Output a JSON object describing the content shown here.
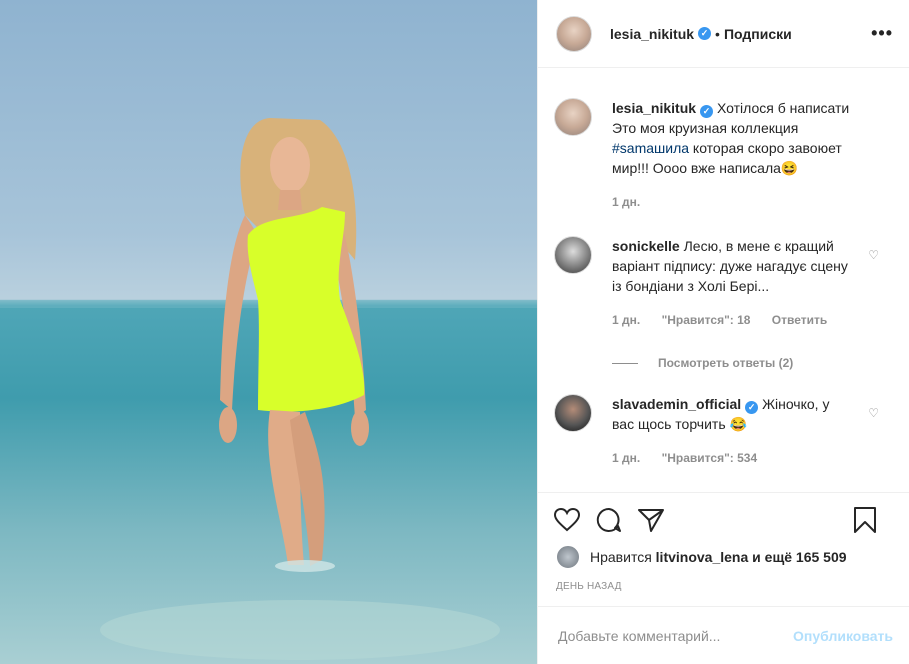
{
  "post": {
    "image_alt": "Woman in neon dress standing in the sea",
    "author": "lesia_nikituk",
    "follow_label": "Подписки",
    "caption_parts": {
      "text1": "Хотілося б написати Это моя круизная коллекция ",
      "hashtag": "#samaшила",
      "text2": " которая скоро завоюет мир!!! Оооо вже написала😆"
    },
    "caption_time": "1 дн.",
    "comments": [
      {
        "user": "sonickelle",
        "text": "Лесю, в мене є кращий варіант підпису: дуже нагадує сцену із бондіани з Холі Бері...",
        "time": "1 дн.",
        "likes": "\"Нравится\": 18",
        "reply": "Ответить",
        "view_replies": "Посмотреть ответы (2)"
      },
      {
        "user": "slavademin_official",
        "text": "Жіночко, у вас щось торчить 😂",
        "time": "1 дн.",
        "likes": "\"Нравится\": 534"
      }
    ],
    "likes_prefix": "Нравится",
    "likes_user": "litvinova_lena",
    "likes_suffix": "и ещё 165 509",
    "date_label": "ДЕНЬ НАЗАД",
    "comment_placeholder": "Добавьте комментарий...",
    "publish_label": "Опубликовать"
  },
  "colors": {
    "accent": "#3897f0",
    "muted": "#8e8e8e",
    "publish_disabled": "#b2dffc",
    "dress": "#d8ff2a"
  },
  "icons": [
    "heart-icon",
    "comment-icon",
    "share-icon",
    "bookmark-icon",
    "more-icon",
    "verified-icon"
  ]
}
